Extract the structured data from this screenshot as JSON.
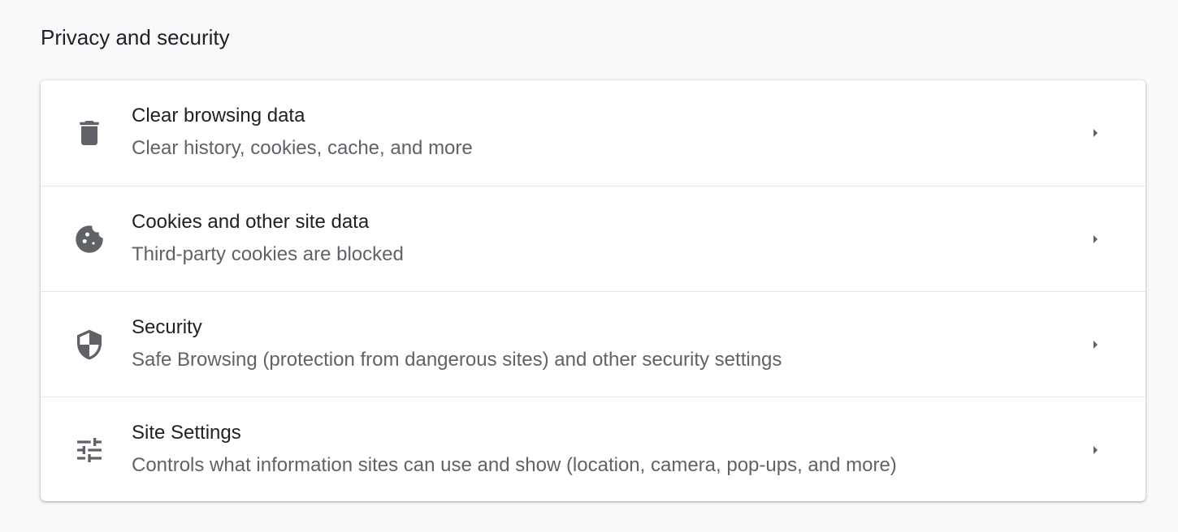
{
  "section": {
    "title": "Privacy and security"
  },
  "rows": [
    {
      "icon": "trash-icon",
      "title": "Clear browsing data",
      "subtitle": "Clear history, cookies, cache, and more"
    },
    {
      "icon": "cookie-icon",
      "title": "Cookies and other site data",
      "subtitle": "Third-party cookies are blocked"
    },
    {
      "icon": "shield-icon",
      "title": "Security",
      "subtitle": "Safe Browsing (protection from dangerous sites) and other security settings"
    },
    {
      "icon": "tune-icon",
      "title": "Site Settings",
      "subtitle": "Controls what information sites can use and show (location, camera, pop-ups, and more)"
    }
  ],
  "colors": {
    "page_background": "#f8f9fa",
    "card_background": "#ffffff",
    "primary_text": "#202124",
    "secondary_text": "#5f6368",
    "icon": "#5f6368",
    "divider": "#e6e6e6"
  }
}
